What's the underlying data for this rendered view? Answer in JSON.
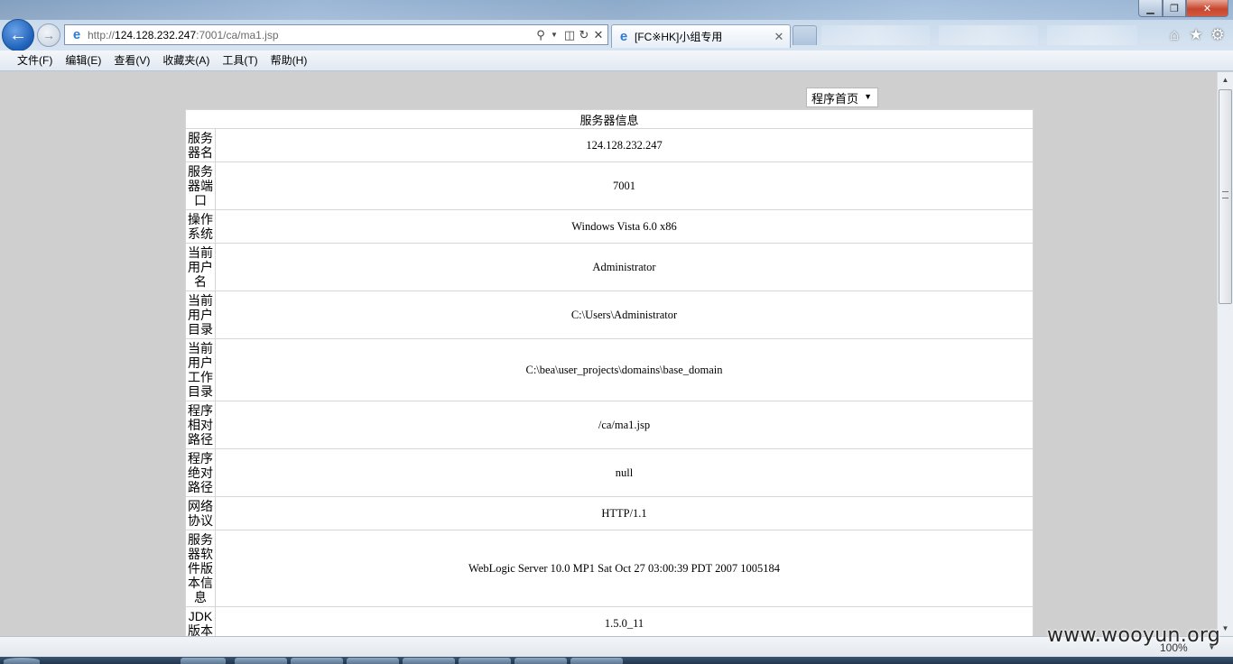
{
  "window": {
    "controls": {
      "minimize": "▁",
      "maximize": "❐",
      "close": "✕"
    }
  },
  "navigation": {
    "back_icon": "back-arrow-icon",
    "forward_icon": "forward-arrow-icon",
    "address_prefix": "http://",
    "address_host": "124.128.232.247",
    "address_path": ":7001/ca/ma1.jsp"
  },
  "tab": {
    "title": "[FC※HK]小组专用",
    "close": "✕"
  },
  "menu": {
    "items": [
      "文件(F)",
      "编辑(E)",
      "查看(V)",
      "收藏夹(A)",
      "工具(T)",
      "帮助(H)"
    ]
  },
  "content": {
    "program_select": "程序首页",
    "table_title": "服务器信息",
    "rows": [
      {
        "label": "服务器名",
        "value": "124.128.232.247"
      },
      {
        "label": "服务器端口",
        "value": "7001"
      },
      {
        "label": "操作系统",
        "value": "Windows Vista 6.0 x86"
      },
      {
        "label": "当前用户名",
        "value": "Administrator"
      },
      {
        "label": "当前用户目录",
        "value": "C:\\Users\\Administrator"
      },
      {
        "label": "当前用户工作目录",
        "value": "C:\\bea\\user_projects\\domains\\base_domain"
      },
      {
        "label": "程序相对路径",
        "value": "/ca/ma1.jsp"
      },
      {
        "label": "程序绝对路径",
        "value": "null"
      },
      {
        "label": "网络协议",
        "value": "HTTP/1.1"
      },
      {
        "label": "服务器软件版本信息",
        "value": "WebLogic Server 10.0 MP1 Sat Oct 27 03:00:39 PDT 2007 1005184"
      },
      {
        "label": "JDK版本",
        "value": "1.5.0_11"
      }
    ]
  },
  "status": {
    "zoom": "100%",
    "watermark": "www.wooyun.org"
  }
}
